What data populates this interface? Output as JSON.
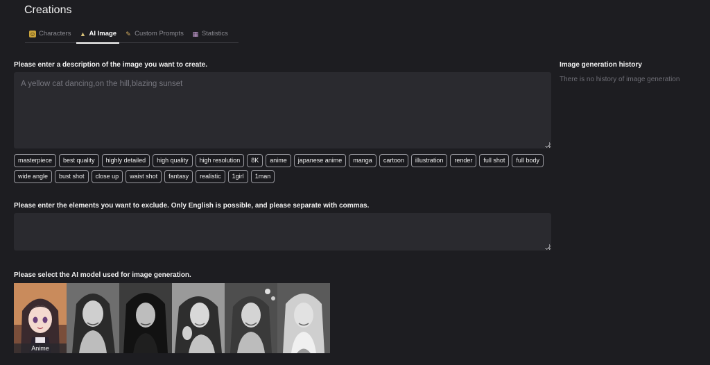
{
  "page": {
    "title": "Creations"
  },
  "tabs": [
    {
      "label": "Characters",
      "icon": "character-icon",
      "active": false
    },
    {
      "label": "AI Image",
      "icon": "ai-image-icon",
      "active": true
    },
    {
      "label": "Custom Prompts",
      "icon": "pen-icon",
      "active": false
    },
    {
      "label": "Statistics",
      "icon": "chart-icon",
      "active": false
    }
  ],
  "prompt": {
    "label": "Please enter a description of the image you want to create.",
    "placeholder": "A yellow cat dancing,on the hill,blazing sunset",
    "value": ""
  },
  "tags": [
    "masterpiece",
    "best quality",
    "highly detailed",
    "high quality",
    "high resolution",
    "8K",
    "anime",
    "japanese anime",
    "manga",
    "cartoon",
    "illustration",
    "render",
    "full shot",
    "full body",
    "wide angle",
    "bust shot",
    "close up",
    "waist shot",
    "fantasy",
    "realistic",
    "1girl",
    "1man"
  ],
  "exclude": {
    "label": "Please enter the elements you want to exclude. Only English is possible, and please separate with commas.",
    "placeholder": "",
    "value": ""
  },
  "models": {
    "label": "Please select the AI model used for image generation.",
    "items": [
      {
        "name": "Anime",
        "style": "anime",
        "selected": true
      },
      {
        "name": "",
        "style": "photo"
      },
      {
        "name": "",
        "style": "photo"
      },
      {
        "name": "",
        "style": "photo"
      },
      {
        "name": "",
        "style": "photo"
      },
      {
        "name": "",
        "style": "photo"
      }
    ]
  },
  "history": {
    "title": "Image generation history",
    "empty_text": "There is no history of image generation"
  },
  "colors": {
    "background": "#1d1d21",
    "input_bg": "#2a2a2f",
    "chip_border": "#9a9aa0"
  }
}
